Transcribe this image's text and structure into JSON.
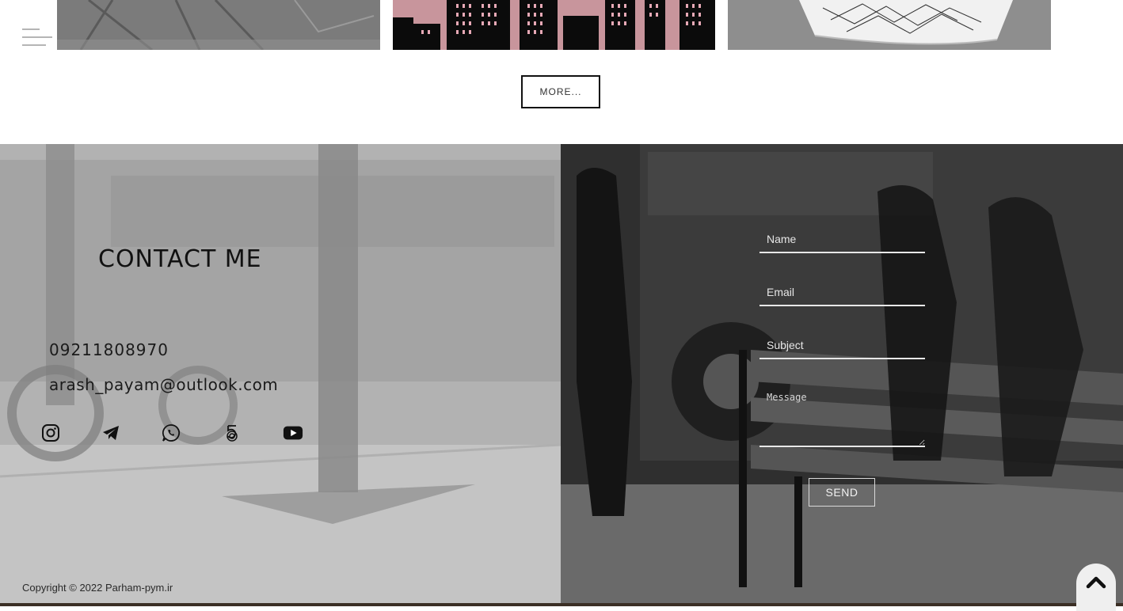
{
  "gallery": {
    "more_label": "MORE..."
  },
  "contact": {
    "title": "CONTACT ME",
    "phone": "09211808970",
    "email": "arash_payam@outlook.com",
    "socials": [
      "instagram-icon",
      "telegram-icon",
      "whatsapp-icon",
      "500px-icon",
      "youtube-icon"
    ]
  },
  "form": {
    "name_placeholder": "Name",
    "email_placeholder": "Email",
    "subject_placeholder": "Subject",
    "message_placeholder": "Message",
    "send_label": "SEND"
  },
  "footer": {
    "copyright": "Copyright © 2022 Parham-pym.ir"
  },
  "colors": {
    "left_panel": "#b4b4b4",
    "right_panel": "#333333",
    "text_dark": "#111111",
    "field_line": "#e8e8e8"
  }
}
